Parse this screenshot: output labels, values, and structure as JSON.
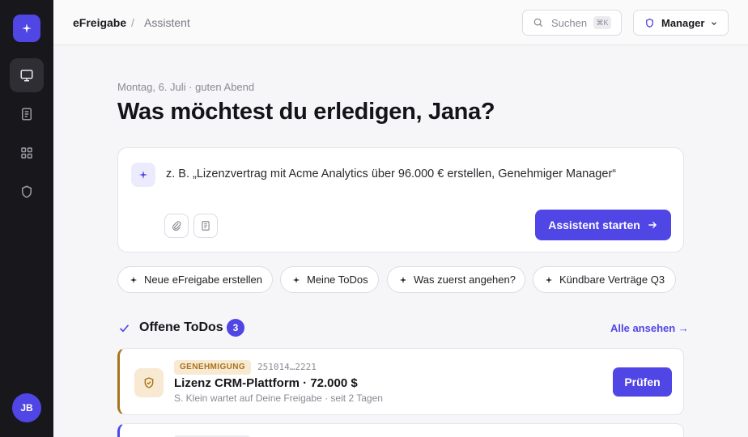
{
  "sidebar": {
    "logo_icon": "sparkle-icon",
    "items": [
      {
        "name": "monitor-icon",
        "active": true
      },
      {
        "name": "document-icon",
        "active": false
      },
      {
        "name": "grid-icon",
        "active": false
      },
      {
        "name": "shield-icon",
        "active": false
      }
    ],
    "avatar_initials": "JB"
  },
  "header": {
    "breadcrumb_root": "eFreigabe",
    "breadcrumb_sep": "/",
    "breadcrumb_current": "Assistent",
    "search_placeholder": "Suchen",
    "search_shortcut": "⌘K",
    "role_label": "Manager"
  },
  "main": {
    "greeting": "Montag, 6. Juli · guten Abend",
    "headline": "Was möchtest du erledigen, Jana?",
    "prompt_placeholder": "z. B. „Lizenzvertrag mit Acme Analytics über 96.000 € erstellen, Genehmiger Manager“",
    "start_button": "Assistent starten",
    "chips": [
      "Neue eFreigabe erstellen",
      "Meine ToDos",
      "Was zuerst angehen?",
      "Kündbare Verträge Q3"
    ],
    "todos": {
      "title": "Offene ToDos",
      "count": "3",
      "see_all": "Alle ansehen →",
      "items": [
        {
          "badge": "GENEHMIGUNG",
          "ref": "251014…2221",
          "title": "Lizenz CRM-Plattform · 72.000 $",
          "subtitle": "S. Klein wartet auf Deine Freigabe · seit 2 Tagen",
          "action": "Prüfen"
        }
      ]
    }
  },
  "colors": {
    "accent": "#4f46e5",
    "sidebar_bg": "#18181c",
    "approval": "#a8741c",
    "approval_bg": "#f8ead2"
  }
}
